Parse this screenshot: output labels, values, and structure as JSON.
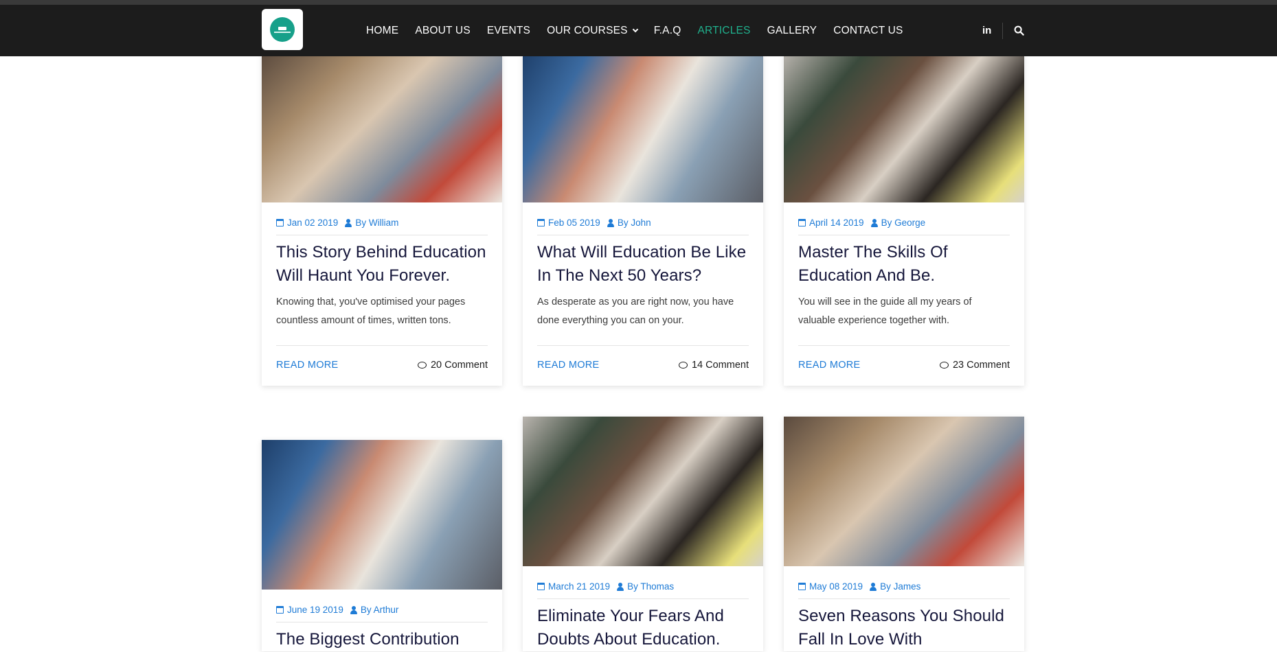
{
  "nav": {
    "items": [
      {
        "label": "HOME",
        "active": false
      },
      {
        "label": "ABOUT US",
        "active": false
      },
      {
        "label": "EVENTS",
        "active": false
      },
      {
        "label": "OUR COURSES",
        "active": false,
        "dropdown": true
      },
      {
        "label": "F.A.Q",
        "active": false
      },
      {
        "label": "ARTICLES",
        "active": true
      },
      {
        "label": "GALLERY",
        "active": false
      },
      {
        "label": "CONTACT US",
        "active": false
      }
    ],
    "linkedin_glyph": "in",
    "icons": [
      "linkedin-icon",
      "search-icon"
    ]
  },
  "colors": {
    "accent": "#1e7bd6",
    "active_nav": "#20b28e",
    "navbar": "#1c1c1c",
    "logo": "#17a08a"
  },
  "articles": [
    {
      "date": "Jan 02 2019",
      "author": "By William",
      "title": "This Story Behind Education Will Haunt You Forever.",
      "excerpt": "Knowing that, you've optimised your pages countless amount of times, written tons.",
      "read_more": "READ MORE",
      "comments": "20 Comment"
    },
    {
      "date": "Feb 05 2019",
      "author": "By John",
      "title": "What Will Education Be Like In The Next 50 Years?",
      "excerpt": "As desperate as you are right now, you have done everything you can on your.",
      "read_more": "READ MORE",
      "comments": "14 Comment"
    },
    {
      "date": "April 14 2019",
      "author": "By George",
      "title": "Master The Skills Of Education And Be.",
      "excerpt": "You will see in the guide all my years of valuable experience together with.",
      "read_more": "READ MORE",
      "comments": "23 Comment"
    },
    {
      "date": "June 19 2019",
      "author": "By Arthur",
      "title": "The Biggest Contribution",
      "excerpt": "",
      "read_more": "",
      "comments": ""
    },
    {
      "date": "March 21 2019",
      "author": "By Thomas",
      "title": "Eliminate Your Fears And Doubts About Education.",
      "excerpt": "",
      "read_more": "",
      "comments": ""
    },
    {
      "date": "May 08 2019",
      "author": "By James",
      "title": "Seven Reasons You Should Fall In Love With",
      "excerpt": "",
      "read_more": "",
      "comments": ""
    }
  ]
}
